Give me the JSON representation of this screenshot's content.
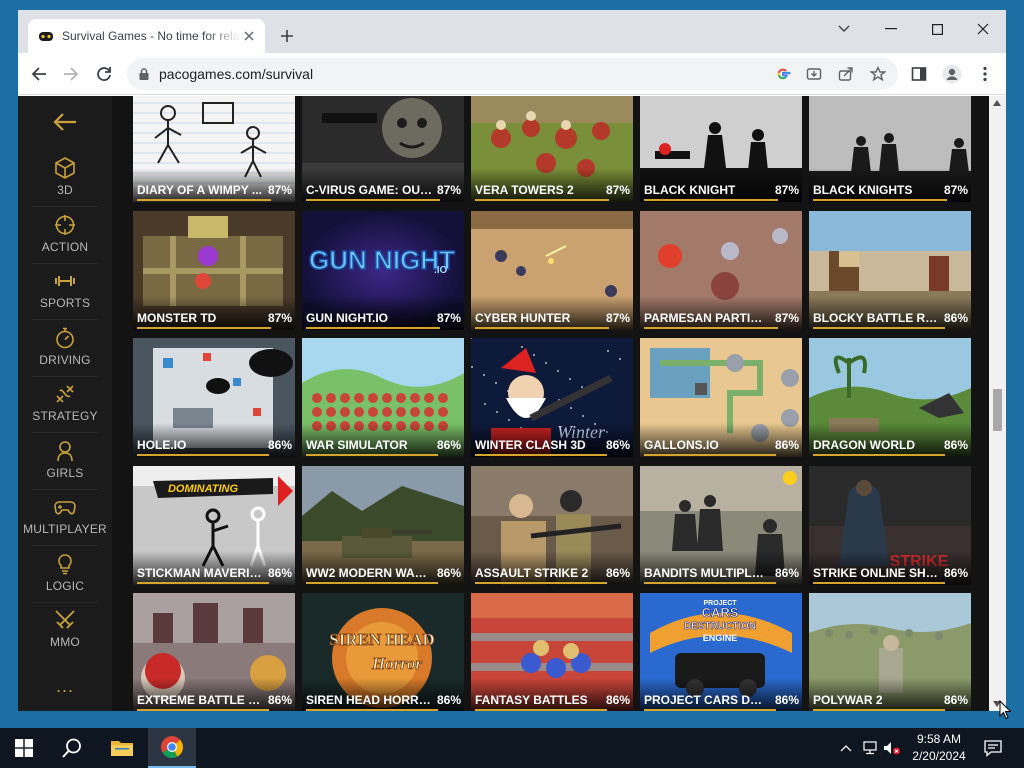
{
  "browser": {
    "tab_title": "Survival Games - No time for relaxing",
    "url": "pacogames.com/survival",
    "accent": "#d4a52a"
  },
  "sidebar": {
    "items": [
      {
        "label": "3D",
        "icon": "cube-icon"
      },
      {
        "label": "ACTION",
        "icon": "crosshair-icon"
      },
      {
        "label": "SPORTS",
        "icon": "dumbbell-icon"
      },
      {
        "label": "DRIVING",
        "icon": "stopwatch-icon"
      },
      {
        "label": "STRATEGY",
        "icon": "strategy-icon"
      },
      {
        "label": "GIRLS",
        "icon": "girl-icon"
      },
      {
        "label": "MULTIPLAYER",
        "icon": "gamepad-icon"
      },
      {
        "label": "LOGIC",
        "icon": "lightbulb-icon"
      },
      {
        "label": "MMO",
        "icon": "swords-icon"
      }
    ],
    "more": "..."
  },
  "games": [
    {
      "title": "DIARY OF A WIMPY ...",
      "rating": "87%",
      "rating_value": 0.87
    },
    {
      "title": "C-VIRUS GAME: OUT...",
      "rating": "87%",
      "rating_value": 0.87
    },
    {
      "title": "VERA TOWERS 2",
      "rating": "87%",
      "rating_value": 0.87
    },
    {
      "title": "BLACK KNIGHT",
      "rating": "87%",
      "rating_value": 0.87
    },
    {
      "title": "BLACK KNIGHTS",
      "rating": "87%",
      "rating_value": 0.87
    },
    {
      "title": "MONSTER TD",
      "rating": "87%",
      "rating_value": 0.87
    },
    {
      "title": "GUN NIGHT.IO",
      "rating": "87%",
      "rating_value": 0.87
    },
    {
      "title": "CYBER HUNTER",
      "rating": "87%",
      "rating_value": 0.87
    },
    {
      "title": "PARMESAN PARTISA...",
      "rating": "87%",
      "rating_value": 0.87
    },
    {
      "title": "BLOCKY BATTLE RO...",
      "rating": "86%",
      "rating_value": 0.86
    },
    {
      "title": "HOLE.IO",
      "rating": "86%",
      "rating_value": 0.86
    },
    {
      "title": "WAR SIMULATOR",
      "rating": "86%",
      "rating_value": 0.86
    },
    {
      "title": "WINTER CLASH 3D",
      "rating": "86%",
      "rating_value": 0.86
    },
    {
      "title": "GALLONS.IO",
      "rating": "86%",
      "rating_value": 0.86
    },
    {
      "title": "DRAGON WORLD",
      "rating": "86%",
      "rating_value": 0.86
    },
    {
      "title": "STICKMAN MAVERIC...",
      "rating": "86%",
      "rating_value": 0.86
    },
    {
      "title": "WW2 MODERN WAR...",
      "rating": "86%",
      "rating_value": 0.86
    },
    {
      "title": "ASSAULT STRIKE 2",
      "rating": "86%",
      "rating_value": 0.86
    },
    {
      "title": "BANDITS MULTIPLA...",
      "rating": "86%",
      "rating_value": 0.86
    },
    {
      "title": "STRIKE ONLINE SHO...",
      "rating": "86%",
      "rating_value": 0.86
    },
    {
      "title": "EXTREME BATTLE PI...",
      "rating": "86%",
      "rating_value": 0.86
    },
    {
      "title": "SIREN HEAD HORROR",
      "rating": "86%",
      "rating_value": 0.86
    },
    {
      "title": "FANTASY BATTLES",
      "rating": "86%",
      "rating_value": 0.86
    },
    {
      "title": "PROJECT CARS DEST...",
      "rating": "86%",
      "rating_value": 0.86
    },
    {
      "title": "POLYWAR 2",
      "rating": "86%",
      "rating_value": 0.86
    }
  ],
  "thumb_text": {
    "gun_night": "GUN NIGHT",
    "gun_night_io": ".IO",
    "dominating": "DOMINATING",
    "siren_1": "SIREN HEAD",
    "siren_2": "Horror",
    "strike": "STRIKE",
    "winter": "Winter",
    "cars_1": "CARS",
    "cars_2": "DESTRUCTION",
    "cars_3": "ENGINE",
    "project": "PROJECT"
  },
  "taskbar": {
    "time": "9:58 AM",
    "date": "2/20/2024"
  }
}
